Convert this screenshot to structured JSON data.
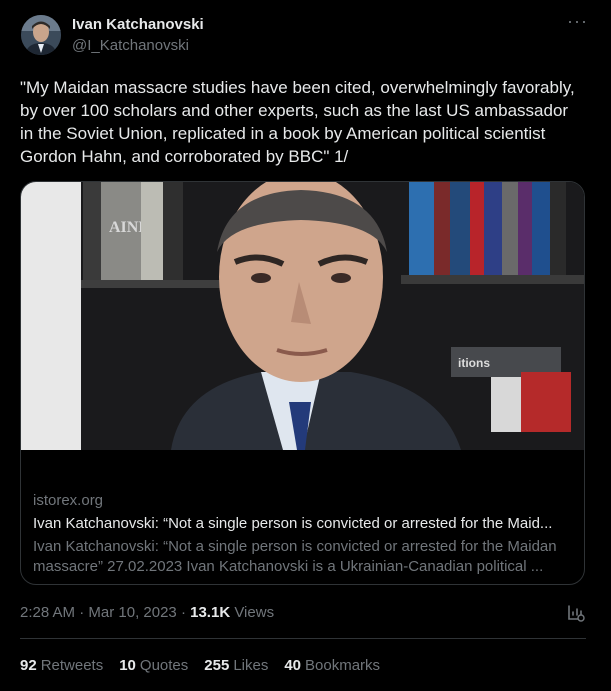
{
  "author": {
    "name": "Ivan Katchanovski",
    "handle": "@I_Katchanovski"
  },
  "tweet": {
    "text": "\"My Maidan massacre studies have been cited, overwhelmingly favorably, by over 100 scholars and other experts, such as the last US ambassador in the Soviet Union, replicated in a book by American political scientist Gordon Hahn, and corroborated by BBC\" 1/"
  },
  "card": {
    "domain": "istorex.org",
    "title": "Ivan Katchanovski: “Not a single person is convicted or arrested for the Maid...",
    "description_line1": "Ivan Katchanovski: “Not a single person is convicted or arrested for the Maidan",
    "description_line2": "massacre” 27.02.2023 Ivan Katchanovski is a Ukrainian-Canadian political ...",
    "image_book_spine": "AINE",
    "image_book_label": "itions"
  },
  "meta": {
    "time": "2:28 AM",
    "separator1": "·",
    "date": "Mar 10, 2023",
    "separator2": "·",
    "views_count": "13.1K",
    "views_label": "Views"
  },
  "stats": {
    "retweets_count": "92",
    "retweets_label": "Retweets",
    "quotes_count": "10",
    "quotes_label": "Quotes",
    "likes_count": "255",
    "likes_label": "Likes",
    "bookmarks_count": "40",
    "bookmarks_label": "Bookmarks"
  },
  "colors": {
    "background": "#000000",
    "text_primary": "#e7e9ea",
    "text_secondary": "#71767b",
    "border": "#2f3336"
  },
  "icons": {
    "more": "more-horizontal-icon",
    "analytics": "analytics-icon"
  }
}
